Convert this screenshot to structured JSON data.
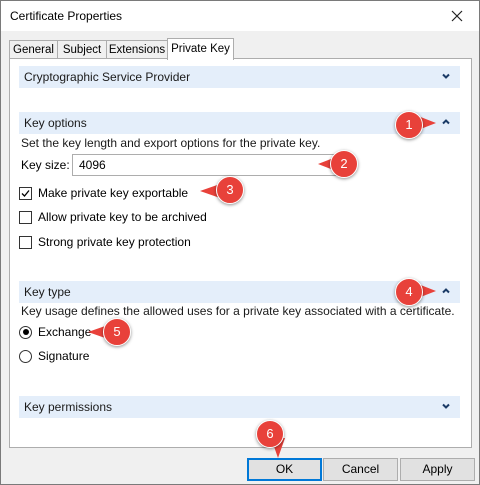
{
  "window": {
    "title": "Certificate Properties"
  },
  "tabs": [
    "General",
    "Subject",
    "Extensions",
    "Private Key"
  ],
  "sections": {
    "csp": {
      "title": "Cryptographic Service Provider"
    },
    "key_options": {
      "title": "Key options",
      "description": "Set the key length and export options for the private key.",
      "key_size_label": "Key size:",
      "key_size_value": "4096",
      "options": [
        {
          "label": "Make private key exportable",
          "checked": true
        },
        {
          "label": "Allow private key to be archived",
          "checked": false
        },
        {
          "label": "Strong private key protection",
          "checked": false
        }
      ]
    },
    "key_type": {
      "title": "Key type",
      "description": "Key usage defines the allowed uses for a private key associated with a certificate.",
      "options": [
        {
          "label": "Exchange",
          "selected": true
        },
        {
          "label": "Signature",
          "selected": false
        }
      ]
    },
    "key_permissions": {
      "title": "Key permissions"
    }
  },
  "buttons": {
    "ok": "OK",
    "cancel": "Cancel",
    "apply": "Apply"
  },
  "callouts": [
    "1",
    "2",
    "3",
    "4",
    "5",
    "6"
  ],
  "colors": {
    "accent": "#0078d7",
    "section_bg": "#e4eefa",
    "callout": "#e8413a"
  }
}
